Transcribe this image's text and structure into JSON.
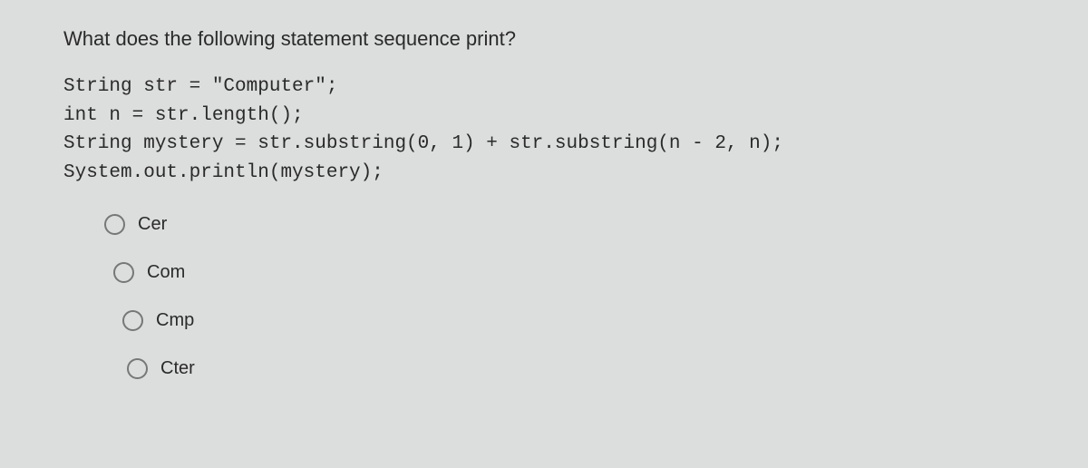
{
  "question": "What does the following statement sequence print?",
  "code": "String str = \"Computer\";\nint n = str.length();\nString mystery = str.substring(0, 1) + str.substring(n - 2, n);\nSystem.out.println(mystery);",
  "options": [
    {
      "label": "Cer"
    },
    {
      "label": "Com"
    },
    {
      "label": "Cmp"
    },
    {
      "label": "Cter"
    }
  ]
}
